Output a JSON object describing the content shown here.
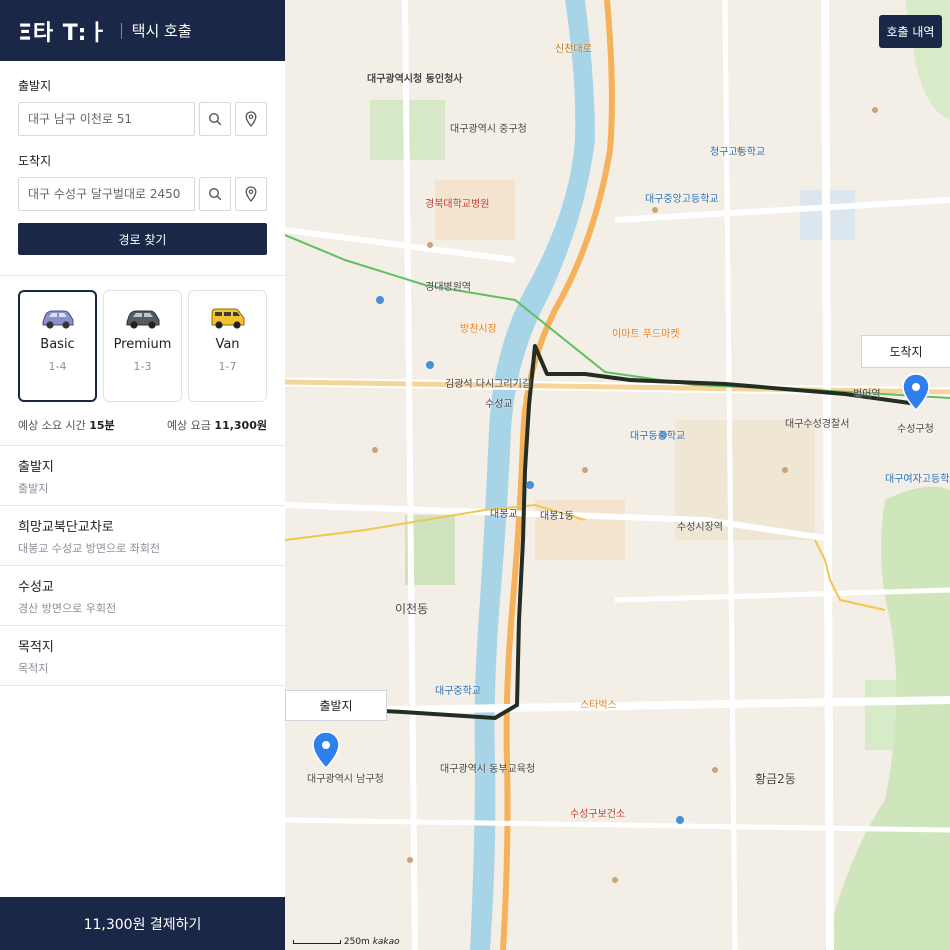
{
  "app": {
    "logo": "Ξ타 T:ㅏ",
    "title": "택시 호출"
  },
  "form": {
    "origin_label": "출발지",
    "origin_value": "대구 남구 이천로 51",
    "dest_label": "도착지",
    "dest_value": "대구 수성구 달구벌대로 2450",
    "route_button": "경로 찾기"
  },
  "cars": [
    {
      "name": "Basic",
      "pax": "1-4",
      "color": "#8a8fcf"
    },
    {
      "name": "Premium",
      "pax": "1-3",
      "color": "#555b5e"
    },
    {
      "name": "Van",
      "pax": "1-7",
      "color": "#f2c230"
    }
  ],
  "estimate": {
    "time_label": "예상 소요 시간",
    "time_value": "15분",
    "fare_label": "예상 요금",
    "fare_value": "11,300원"
  },
  "steps": [
    {
      "title": "출발지",
      "sub": "출발지"
    },
    {
      "title": "희망교북단교차로",
      "sub": "대봉교 수성교 방면으로 좌회전"
    },
    {
      "title": "수성교",
      "sub": "경산 방면으로 우회전"
    },
    {
      "title": "목적지",
      "sub": "목적지"
    }
  ],
  "pay_button": "11,300원 결제하기",
  "map": {
    "history_button": "호출 내역",
    "dest_tag": "도착지",
    "origin_tag": "출발지",
    "scale": "250m",
    "brand": "kakao",
    "labels": {
      "l1": "대구광역시청 동인청사",
      "l2": "대구광역시 중구청",
      "l3": "대구광역시 남구청",
      "l4": "수성구청",
      "l5": "경북대학교병원",
      "l6": "대구중학교",
      "l7": "수성교",
      "l8": "대봉교",
      "l9": "이천동",
      "l10": "청구고등학교",
      "l11": "대구중앙고등학교",
      "l12": "수성시장역",
      "l13": "범어역",
      "l14": "황금2동",
      "l15": "대구동중학교",
      "l16": "이마트 푸드마켓",
      "l17": "스타벅스",
      "l18": "신천대로",
      "l19": "경대병원역",
      "l20": "방천시장",
      "l21": "대구광역시 동부교육청",
      "l22": "수성구보건소",
      "l23": "김광석 다시그리기길",
      "l24": "대봉1동",
      "l25": "대구수성경찰서",
      "l26": "대구여자고등학교"
    }
  }
}
